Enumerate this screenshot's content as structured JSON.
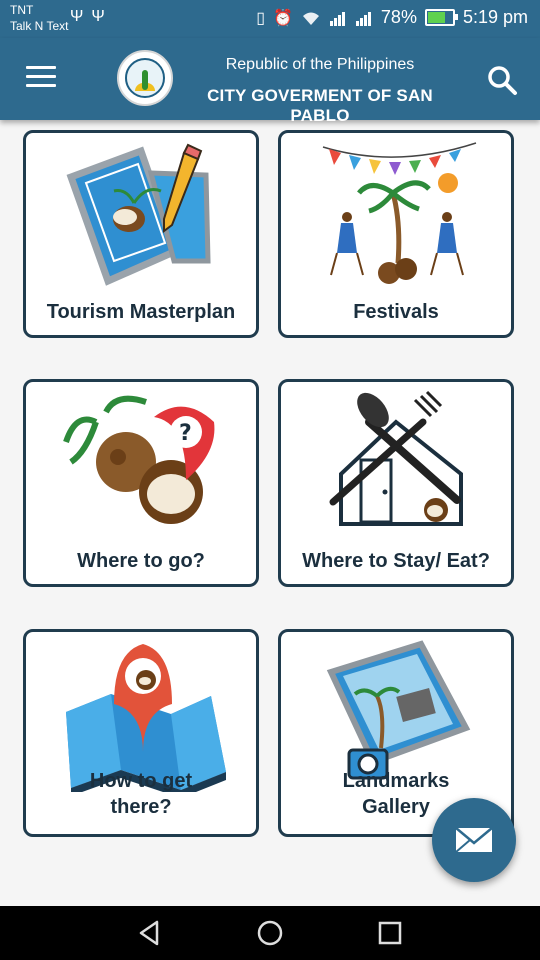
{
  "status_bar": {
    "carrier_line1": "TNT",
    "carrier_line2": "Talk N Text",
    "left_icons": [
      "usb-icon",
      "usb-icon"
    ],
    "right_icons": [
      "vibrate-icon",
      "alarm-icon",
      "wifi-icon",
      "signal-icon",
      "signal-icon"
    ],
    "battery_percent": "78%",
    "battery_level": 0.78,
    "time": "5:19 pm"
  },
  "app_bar": {
    "subtitle": "Republic of the Philippines",
    "title": "CITY GOVERMENT OF SAN PABLO",
    "menu_icon": "hamburger-menu-icon",
    "search_icon": "search-icon",
    "seal_icon": "city-seal-icon"
  },
  "tiles": [
    {
      "label": "Tourism Masterplan",
      "icon": "blueprint-pencil-icon"
    },
    {
      "label": "Festivals",
      "icon": "festival-icon"
    },
    {
      "label": "Where to go?",
      "icon": "coconut-location-icon"
    },
    {
      "label": "Where to Stay/ Eat?",
      "icon": "house-utensils-icon"
    },
    {
      "label": "How to get there?",
      "icon": "map-pin-icon"
    },
    {
      "label": "Landmarks Gallery",
      "icon": "photo-gallery-icon"
    }
  ],
  "fab": {
    "icon": "mail-icon"
  },
  "nav_bar": {
    "icons": [
      "back-icon",
      "home-icon",
      "recents-icon"
    ]
  },
  "colors": {
    "primary": "#2e6a8e",
    "tile_border": "#203c4e",
    "label": "#1b2f3e",
    "background": "#f5f5f5"
  }
}
